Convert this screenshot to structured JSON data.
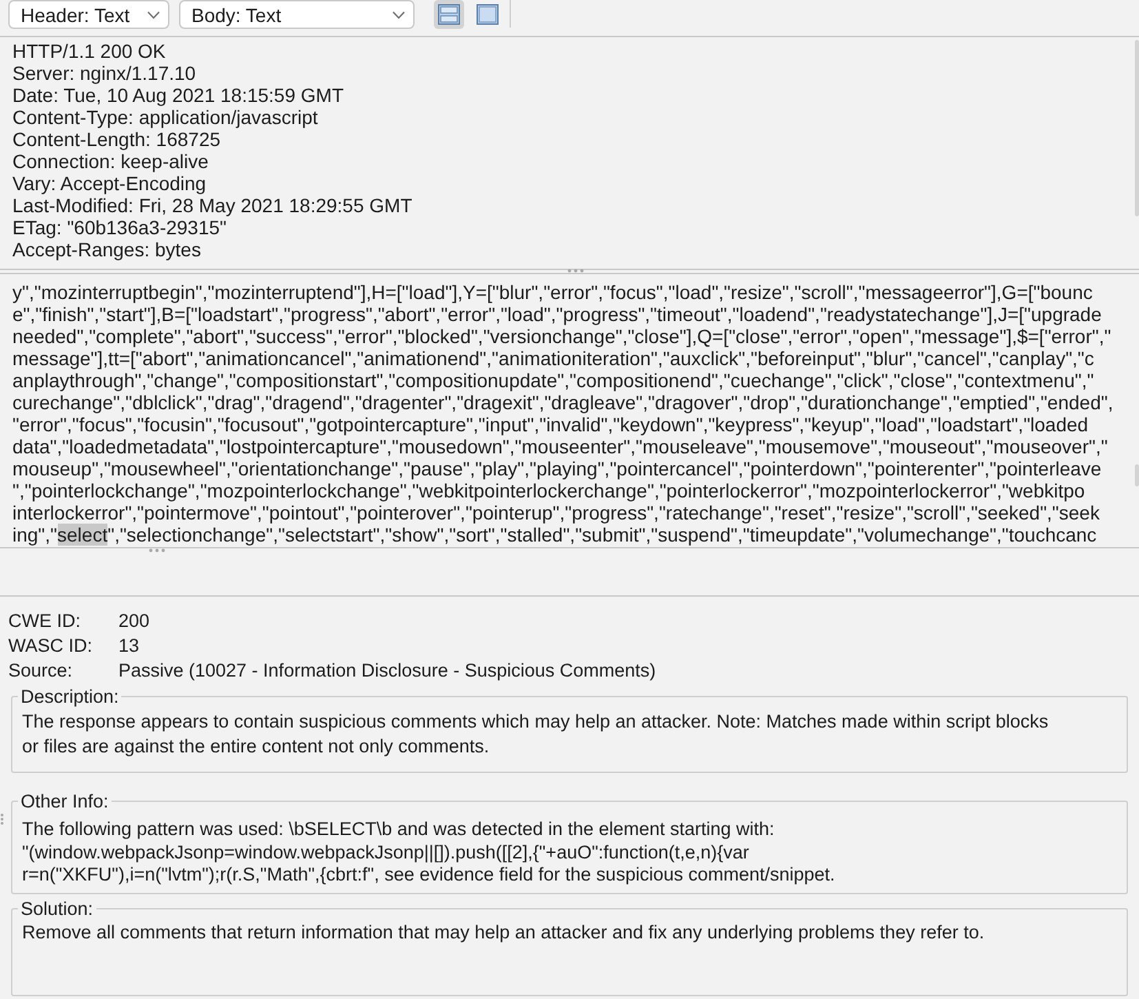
{
  "toolbar": {
    "dropdowns": [
      {
        "label": "Header: Text"
      },
      {
        "label": "Body: Text"
      }
    ],
    "layout_buttons": [
      {
        "kind": "split",
        "selected": true
      },
      {
        "kind": "single",
        "selected": false
      }
    ]
  },
  "response_header": {
    "lines": [
      "HTTP/1.1 200 OK",
      "Server: nginx/1.17.10",
      "Date: Tue, 10 Aug 2021 18:15:59 GMT",
      "Content-Type: application/javascript",
      "Content-Length: 168725",
      "Connection: keep-alive",
      "Vary: Accept-Encoding",
      "Last-Modified: Fri, 28 May 2021 18:29:55 GMT",
      "ETag: \"60b136a3-29315\"",
      "Accept-Ranges: bytes"
    ]
  },
  "response_body": {
    "lines": [
      {
        "segments": [
          {
            "text": "y\",\"mozinterruptbegin\",\"mozinterruptend\"],H=[\"load\"],Y=[\"blur\",\"error\",\"focus\",\"load\",\"resize\",\"scroll\",\"messageerror\"],G=[\"bounc",
            "highlighted": false
          }
        ]
      },
      {
        "segments": [
          {
            "text": "e\",\"finish\",\"start\"],B=[\"loadstart\",\"progress\",\"abort\",\"error\",\"load\",\"progress\",\"timeout\",\"loadend\",\"readystatechange\"],J=[\"upgrade",
            "highlighted": false
          }
        ]
      },
      {
        "segments": [
          {
            "text": "needed\",\"complete\",\"abort\",\"success\",\"error\",\"blocked\",\"versionchange\",\"close\"],Q=[\"close\",\"error\",\"open\",\"message\"],$=[\"error\",\"",
            "highlighted": false
          }
        ]
      },
      {
        "segments": [
          {
            "text": "message\"],tt=[\"abort\",\"animationcancel\",\"animationend\",\"animationiteration\",\"auxclick\",\"beforeinput\",\"blur\",\"cancel\",\"canplay\",\"c",
            "highlighted": false
          }
        ]
      },
      {
        "segments": [
          {
            "text": "anplaythrough\",\"change\",\"compositionstart\",\"compositionupdate\",\"compositionend\",\"cuechange\",\"click\",\"close\",\"contextmenu\",\"",
            "highlighted": false
          }
        ]
      },
      {
        "segments": [
          {
            "text": "curechange\",\"dblclick\",\"drag\",\"dragend\",\"dragenter\",\"dragexit\",\"dragleave\",\"dragover\",\"drop\",\"durationchange\",\"emptied\",\"ended\",",
            "highlighted": false
          }
        ]
      },
      {
        "segments": [
          {
            "text": "\"error\",\"focus\",\"focusin\",\"focusout\",\"gotpointercapture\",\"input\",\"invalid\",\"keydown\",\"keypress\",\"keyup\",\"load\",\"loadstart\",\"loaded",
            "highlighted": false
          }
        ]
      },
      {
        "segments": [
          {
            "text": "data\",\"loadedmetadata\",\"lostpointercapture\",\"mousedown\",\"mouseenter\",\"mouseleave\",\"mousemove\",\"mouseout\",\"mouseover\",\"",
            "highlighted": false
          }
        ]
      },
      {
        "segments": [
          {
            "text": "mouseup\",\"mousewheel\",\"orientationchange\",\"pause\",\"play\",\"playing\",\"pointercancel\",\"pointerdown\",\"pointerenter\",\"pointerleave",
            "highlighted": false
          }
        ]
      },
      {
        "segments": [
          {
            "text": "\",\"pointerlockchange\",\"mozpointerlockchange\",\"webkitpointerlockerchange\",\"pointerlockerror\",\"mozpointerlockerror\",\"webkitpo",
            "highlighted": false
          }
        ]
      },
      {
        "segments": [
          {
            "text": "interlockerror\",\"pointermove\",\"pointout\",\"pointerover\",\"pointerup\",\"progress\",\"ratechange\",\"reset\",\"resize\",\"scroll\",\"seeked\",\"seek",
            "highlighted": false
          }
        ]
      },
      {
        "segments": [
          {
            "text": "ing\",\"",
            "highlighted": false
          },
          {
            "text": "select",
            "highlighted": true
          },
          {
            "text": "\",\"selectionchange\",\"selectstart\",\"show\",\"sort\",\"stalled\",\"submit\",\"suspend\",\"timeupdate\",\"volumechange\",\"touchcanc",
            "highlighted": false
          }
        ]
      }
    ]
  },
  "alert": {
    "fields": [
      {
        "label": "CWE ID:",
        "value": "200"
      },
      {
        "label": "WASC ID:",
        "value": "13"
      },
      {
        "label": "Source:",
        "value": "Passive (10027 - Information Disclosure - Suspicious Comments)"
      }
    ],
    "sections": [
      {
        "title": "Description:",
        "text": "The response appears to contain suspicious comments which may help an attacker. Note: Matches made within script blocks or files are against the entire content not only comments."
      },
      {
        "title": "Other Info:",
        "text": "The following pattern was used: \\bSELECT\\b and was detected in the element starting with:\n\"(window.webpackJsonp=window.webpackJsonp||[]).push([[2],{\"+auO\":function(t,e,n){var\nr=n(\"XKFU\"),i=n(\"lvtm\");r(r.S,\"Math\",{cbrt:f\", see evidence field for the suspicious comment/snippet."
      },
      {
        "title": "Solution:",
        "text": "Remove all comments that return information that may help an attacker and fix any underlying problems they refer to."
      }
    ]
  }
}
